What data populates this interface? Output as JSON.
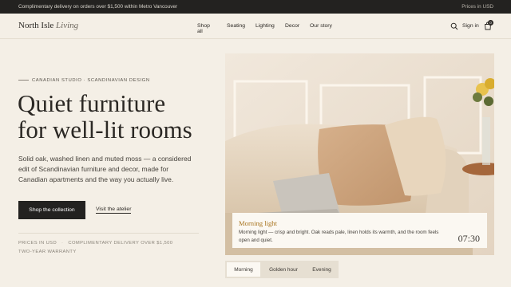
{
  "topbar": {
    "message": "Complimentary delivery on orders over $1,500 within Metro Vancouver",
    "prices": "Prices in USD"
  },
  "header": {
    "logo_main": "North Isle",
    "logo_italic": "Living",
    "nav": [
      "Shop all",
      "Seating",
      "Lighting",
      "Decor",
      "Our story"
    ],
    "sign_in": "Sign in",
    "cart_count": "0"
  },
  "hero": {
    "eyebrow": "CANADIAN STUDIO · SCANDINAVIAN DESIGN",
    "headline_line1": "Quiet furniture",
    "headline_line2": "for well-lit rooms",
    "lede_line1": "Solid oak, washed linen and muted moss — a considered",
    "lede_line2": "edit of Scandinavian furniture and decor, made for",
    "lede_line3": "Canadian apartments and the way you actually live.",
    "primary_cta": "Shop the collection",
    "secondary_cta": "Visit the atelier",
    "meta_prices": "PRICES IN USD",
    "meta_sep": "·",
    "meta_delivery": "COMPLIMENTARY DELIVERY OVER $1,500",
    "meta_warranty": "TWO-YEAR WARRANTY"
  },
  "caption": {
    "title": "Morning light",
    "text_line1": "Morning light — crisp and bright. Oak reads pale, linen holds its warmth, and the room feels",
    "text_line2": "open and quiet.",
    "time": "07:30"
  },
  "tabs": {
    "items": [
      "Morning",
      "Golden hour",
      "Evening"
    ],
    "active": "Morning"
  },
  "colors": {
    "accent": "#a8741f",
    "dark": "#232220",
    "background": "#f4efe6"
  }
}
